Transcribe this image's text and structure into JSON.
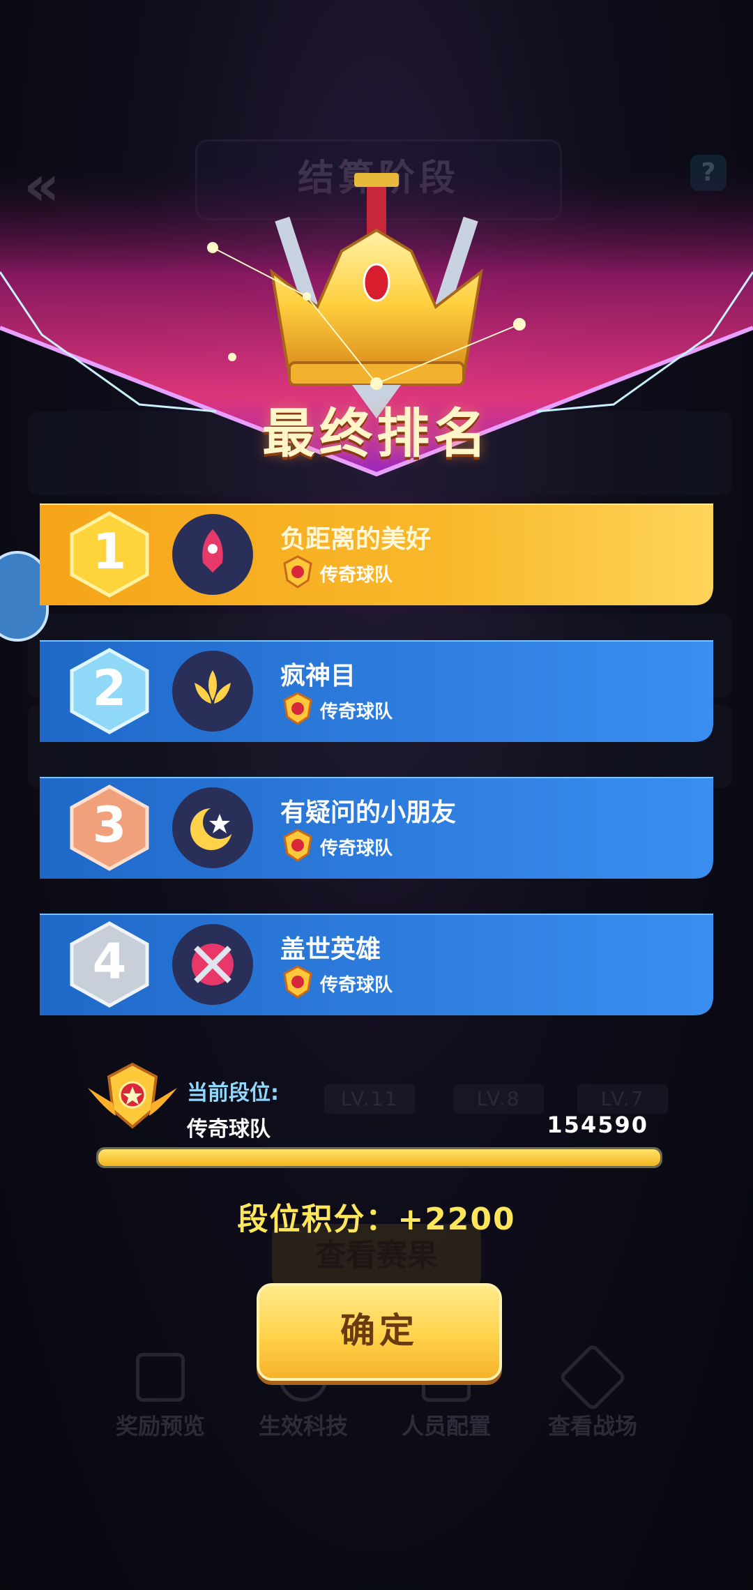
{
  "background": {
    "stage_title": "结算阶段",
    "bottom_nav": [
      {
        "label": "奖励预览",
        "icon": "gift-icon"
      },
      {
        "label": "生效科技",
        "icon": "atom-icon"
      },
      {
        "label": "人员配置",
        "icon": "people-icon"
      },
      {
        "label": "查看战场",
        "icon": "flag-icon"
      }
    ],
    "levels": [
      "LV.11",
      "LV.8",
      "LV.7"
    ],
    "view_button": "查看赛果"
  },
  "header": {
    "title": "最终排名"
  },
  "rankings": [
    {
      "rank": "1",
      "name": "负距离的美好",
      "team": "传奇球队",
      "avatar_icon": "rocket-icon",
      "style": "gold"
    },
    {
      "rank": "2",
      "name": "疯神目",
      "team": "传奇球队",
      "avatar_icon": "lotus-icon",
      "style": "blue"
    },
    {
      "rank": "3",
      "name": "有疑问的小朋友",
      "team": "传奇球队",
      "avatar_icon": "moon-star-icon",
      "style": "blue"
    },
    {
      "rank": "4",
      "name": "盖世英雄",
      "team": "传奇球队",
      "avatar_icon": "crossed-swords-icon",
      "style": "blue"
    }
  ],
  "current_rank": {
    "label": "当前段位:",
    "tier": "传奇球队",
    "score": "154590",
    "progress": 1.0
  },
  "points": {
    "text": "段位积分：+2200"
  },
  "confirm_button": "确定",
  "colors": {
    "gold_card": "#f7b21f",
    "blue_card": "#2f7fe0",
    "points_text": "#ffe65a",
    "button": "#ffd24a"
  }
}
